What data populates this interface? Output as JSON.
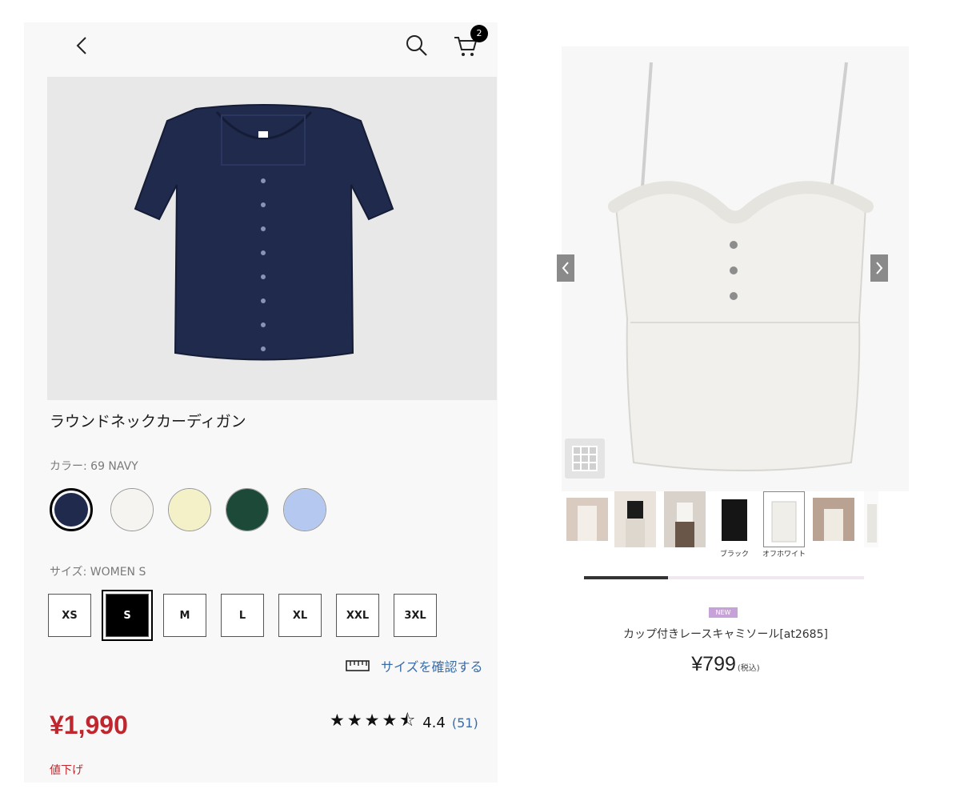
{
  "left": {
    "header": {
      "cart_count": "2"
    },
    "product_name": "ラウンドネックカーディガン",
    "color_label": "カラー:",
    "color_value": "69 NAVY",
    "colors": [
      {
        "name": "navy",
        "hex": "#1f2a4d"
      },
      {
        "name": "off-white",
        "hex": "#f5f4f0"
      },
      {
        "name": "cream",
        "hex": "#f4f1c8"
      },
      {
        "name": "green",
        "hex": "#1d4a38"
      },
      {
        "name": "light-blue",
        "hex": "#b5c9f0"
      }
    ],
    "size_label": "サイズ:",
    "size_value": "WOMEN S",
    "sizes": [
      "XS",
      "S",
      "M",
      "L",
      "XL",
      "XXL",
      "3XL"
    ],
    "selected_size": "S",
    "size_check": "サイズを確認する",
    "price": "¥1,990",
    "rating_stars": "★★★★⯪",
    "rating_score": "4.4",
    "rating_count": "(51)",
    "price_drop": "値下げ"
  },
  "right": {
    "thumb_captions": {
      "black": "ブラック",
      "offwhite": "オフホワイト"
    },
    "new_badge": "NEW",
    "product_name": "カップ付きレースキャミソール[at2685]",
    "price": "¥799",
    "tax": "(税込)"
  },
  "colors": {
    "accent_red": "#c0262d",
    "link_blue": "#3a6ca7"
  }
}
